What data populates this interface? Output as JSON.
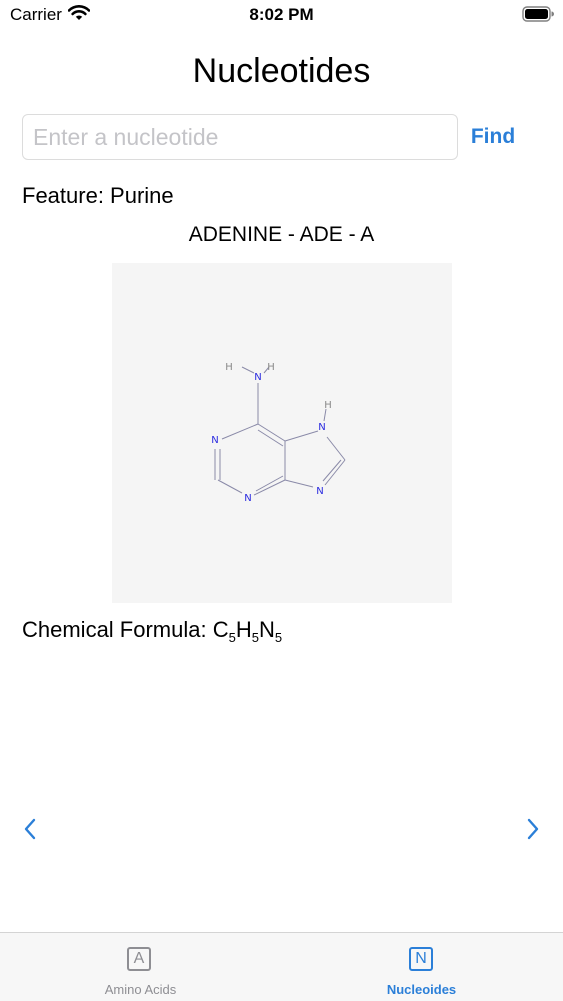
{
  "status_bar": {
    "carrier": "Carrier",
    "time": "8:02 PM"
  },
  "header": {
    "title": "Nucleotides"
  },
  "search": {
    "placeholder": "Enter a nucleotide",
    "value": "",
    "find_label": "Find"
  },
  "feature": {
    "label": "Feature: Purine"
  },
  "nucleotide": {
    "name": "ADENINE - ADE - A",
    "structure": {
      "atoms": {
        "n1": "N",
        "n3": "N",
        "n7": "N",
        "n9": "N",
        "n_amine": "N",
        "h_amine_1": "H",
        "h_amine_2": "H",
        "h_imidazole": "H"
      }
    }
  },
  "formula": {
    "label": "Chemical Formula: ",
    "c": "C",
    "c_count": "5",
    "h": "H",
    "h_count": "5",
    "n": "N",
    "n_count": "5"
  },
  "tab_bar": {
    "tabs": [
      {
        "label": "Amino Acids",
        "icon_letter": "A",
        "active": false
      },
      {
        "label": "Nucleoides",
        "icon_letter": "N",
        "active": true
      }
    ]
  },
  "colors": {
    "accent": "#2b7fd8",
    "inactive": "#8e8e93",
    "nitrogen": "#2a2ae0"
  }
}
